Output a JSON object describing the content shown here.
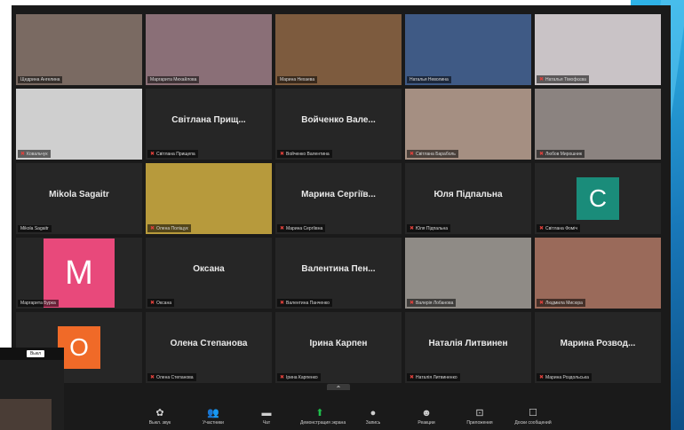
{
  "meeting": {
    "tiles": [
      {
        "type": "video",
        "label": "Щедрина Ангелина",
        "display_name": "",
        "bg": "#7a6a62",
        "active": false,
        "mic_muted": false
      },
      {
        "type": "video",
        "label": "Маргарита Михайлова",
        "display_name": "",
        "bg": "#8a6f77",
        "active": false,
        "mic_muted": false
      },
      {
        "type": "video",
        "label": "Марина Нехаева",
        "display_name": "",
        "bg": "#7d5b3e",
        "active": true,
        "mic_muted": false
      },
      {
        "type": "video",
        "label": "Наталья Неволина",
        "display_name": "",
        "bg": "#3f5a85",
        "active": false,
        "mic_muted": false
      },
      {
        "type": "video",
        "label": "Наталья Тімофєєва",
        "display_name": "",
        "bg": "#c9c3c6",
        "active": false,
        "mic_muted": true
      },
      {
        "type": "video",
        "label": "Ковальчук",
        "display_name": "",
        "bg": "#cfcfcf",
        "active": false,
        "mic_muted": true
      },
      {
        "type": "name",
        "label": "Світлана Прищепа",
        "display_name": "Світлана Прищ...",
        "active": false,
        "mic_muted": true
      },
      {
        "type": "name",
        "label": "Войченко Валентина",
        "display_name": "Войченко Вале...",
        "active": false,
        "mic_muted": true
      },
      {
        "type": "video",
        "label": "Світлана Бараболь",
        "display_name": "",
        "bg": "#a58f82",
        "active": false,
        "mic_muted": true
      },
      {
        "type": "video",
        "label": "Любов Мирошник",
        "display_name": "",
        "bg": "#8b8380",
        "active": false,
        "mic_muted": true
      },
      {
        "type": "name",
        "label": "Mikola Sagaitr",
        "display_name": "Mikola Sagaitr",
        "active": false,
        "mic_muted": false
      },
      {
        "type": "video",
        "label": "Олена Поліщук",
        "display_name": "",
        "bg": "#b79a3c",
        "active": false,
        "mic_muted": true
      },
      {
        "type": "name",
        "label": "Марина Сергіївна",
        "display_name": "Марина Сергіїв...",
        "active": false,
        "mic_muted": true
      },
      {
        "type": "name",
        "label": "Юля Підпальна",
        "display_name": "Юля Підпальна",
        "active": false,
        "mic_muted": true
      },
      {
        "type": "avatar",
        "label": "Світлана Фоміч",
        "letter": "C",
        "avatar_color": "#1a8c7a",
        "active": false,
        "mic_muted": true
      },
      {
        "type": "avatar",
        "label": "Маргарита Бурка",
        "letter": "M",
        "avatar_color": "#e8497b",
        "big": true,
        "active": false,
        "mic_muted": false
      },
      {
        "type": "name",
        "label": "Оксана",
        "display_name": "Оксана",
        "active": false,
        "mic_muted": true
      },
      {
        "type": "name",
        "label": "Валентина Панченко",
        "display_name": "Валентина Пен...",
        "active": false,
        "mic_muted": true
      },
      {
        "type": "video",
        "label": "Валерія Лобанова",
        "display_name": "",
        "bg": "#8f8b86",
        "active": false,
        "mic_muted": true
      },
      {
        "type": "video",
        "label": "Людмила Мисюра",
        "display_name": "",
        "bg": "#9a6a5a",
        "active": false,
        "mic_muted": true
      },
      {
        "type": "avatar",
        "label": "Осипова",
        "letter": "O",
        "avatar_color": "#f06a28",
        "active": false,
        "mic_muted": false
      },
      {
        "type": "name",
        "label": "Олена Степанова",
        "display_name": "Олена Степанова",
        "active": false,
        "mic_muted": true
      },
      {
        "type": "name",
        "label": "Ірина Карпенко",
        "display_name": "Ірина Карпен",
        "active": false,
        "mic_muted": true
      },
      {
        "type": "name",
        "label": "Наталія Литвиненко",
        "display_name": "Наталія Литвинен",
        "active": false,
        "mic_muted": true
      },
      {
        "type": "name",
        "label": "Марина Роздольська",
        "display_name": "Марина Розвод...",
        "active": false,
        "mic_muted": true
      }
    ]
  },
  "toolbar": {
    "items": [
      {
        "icon": "mic-icon",
        "glyph": "✿",
        "label": "Выкл. звук"
      },
      {
        "icon": "participants-icon",
        "glyph": "👥",
        "label": "Участники"
      },
      {
        "icon": "chat-icon",
        "glyph": "▬",
        "label": "Чат"
      },
      {
        "icon": "share-screen-icon",
        "glyph": "⬆",
        "label": "Демонстрация экрана"
      },
      {
        "icon": "record-icon",
        "glyph": "●",
        "label": "Запись"
      },
      {
        "icon": "reactions-icon",
        "glyph": "☻",
        "label": "Реакции"
      },
      {
        "icon": "apps-icon",
        "glyph": "⊡",
        "label": "Приложения"
      },
      {
        "icon": "whiteboard-icon",
        "glyph": "☐",
        "label": "Доски сообщений"
      }
    ],
    "caret": "⌃"
  },
  "self_view": {
    "badge": "Выкл"
  }
}
